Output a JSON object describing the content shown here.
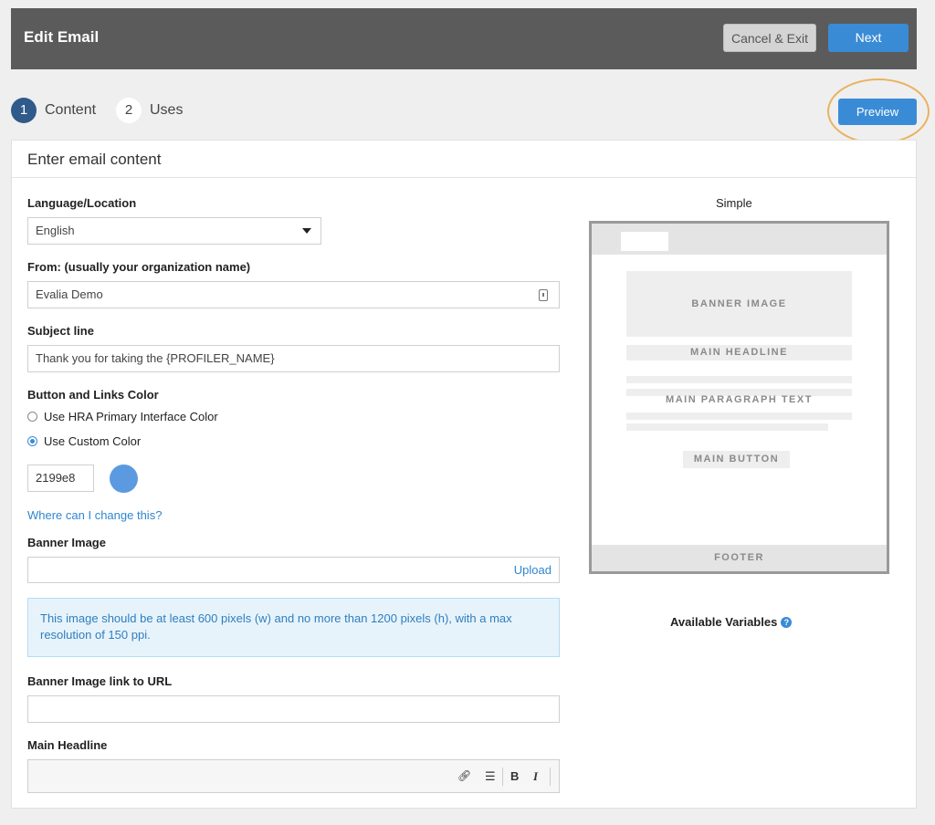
{
  "header": {
    "title": "Edit Email",
    "cancel_label": "Cancel & Exit",
    "next_label": "Next"
  },
  "steps": [
    {
      "number": "1",
      "label": "Content",
      "active": true
    },
    {
      "number": "2",
      "label": "Uses",
      "active": false
    }
  ],
  "preview_label": "Preview",
  "card": {
    "title": "Enter email content"
  },
  "form": {
    "language": {
      "label": "Language/Location",
      "value": "English"
    },
    "from": {
      "label": "From: (usually your organization name)",
      "value": "Evalia Demo"
    },
    "subject": {
      "label": "Subject line",
      "value": "Thank you for taking the {PROFILER_NAME}"
    },
    "color": {
      "label": "Button and Links Color",
      "option_primary": "Use HRA Primary Interface Color",
      "option_custom": "Use Custom Color",
      "selected": "custom",
      "hex": "2199e8",
      "swatch_color": "#5b9ae0"
    },
    "change_link": "Where can I change this?",
    "banner": {
      "label": "Banner Image",
      "upload_label": "Upload",
      "info": "This image should be at least 600 pixels (w) and no more than 1200 pixels (h), with a max resolution of 150 ppi."
    },
    "banner_url": {
      "label": "Banner Image link to URL",
      "value": ""
    },
    "headline": {
      "label": "Main Headline",
      "tools": {
        "bold": "B",
        "italic": "I"
      }
    }
  },
  "template": {
    "name": "Simple",
    "banner": "BANNER IMAGE",
    "headline": "MAIN HEADLINE",
    "paragraph": "MAIN PARAGRAPH TEXT",
    "button": "MAIN BUTTON",
    "footer": "FOOTER"
  },
  "variables_label": "Available Variables",
  "icons": {
    "dropdown": "caret-down-icon",
    "contact": "contact-card-icon",
    "link": "link-icon",
    "list": "bullet-list-icon",
    "help": "question-icon"
  },
  "colors": {
    "accent": "#3a8bd6",
    "topbar": "#5b5b5b",
    "highlight_ring": "#eab25e"
  }
}
